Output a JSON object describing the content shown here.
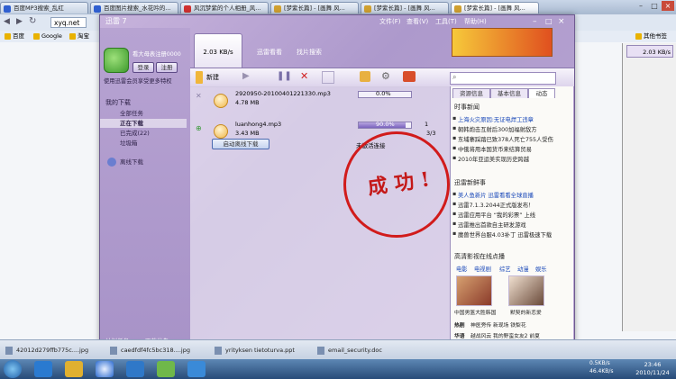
{
  "browser": {
    "tabs": [
      {
        "label": "百度MP3搜索_乱红",
        "color": "#2f5fd0"
      },
      {
        "label": "百度图片搜索_水花吟的...",
        "color": "#2f5fd0"
      },
      {
        "label": "风沉梦紫的个人相册_风...",
        "color": "#d03030"
      },
      {
        "label": "[梦紫长篇] - [画舞 风...",
        "color": "#d0a030"
      },
      {
        "label": "[梦紫长篇] - [画舞 风...",
        "color": "#d0a030"
      },
      {
        "label": "[梦紫长篇] - [画舞 风...",
        "color": "#d0a030"
      }
    ],
    "url": "xyq.net",
    "bookmarks": [
      "百度",
      "Google",
      "淘宝"
    ],
    "other_bookmarks": "其他书签",
    "right_speed": "2.03 KB/s"
  },
  "thunder": {
    "title": "迅雷 7",
    "menus": [
      "文件(F)",
      "查看(V)",
      "工具(T)",
      "帮助(H)"
    ],
    "user_text": "看大母表注册0000",
    "login_label": "登录",
    "register_label": "注册",
    "member_text": "使用迅雷会员享受更多特权",
    "my_downloads": "我的下载",
    "nav": [
      {
        "label": "全部任务"
      },
      {
        "label": "正在下载",
        "selected": true
      },
      {
        "label": "已完成(22)"
      },
      {
        "label": "垃圾箱"
      }
    ],
    "offline": "离线下载",
    "speed": "2.03 KB/s",
    "tabs": [
      "迅雷看看",
      "找片搜索"
    ],
    "new_label": "新建",
    "footer": [
      "计划任务",
      "下载优先"
    ],
    "tasks": [
      {
        "name": "2920950-20100401221330.mp3",
        "size": "4.78 MB",
        "progress": 0.0,
        "progress_text": "0.0%",
        "count": "",
        "status": ""
      },
      {
        "name": "luanhong4.mp3",
        "size": "3.43 MB",
        "progress": 0.9,
        "progress_text": "90.0%",
        "count": "3/3",
        "status": "未激活连接",
        "badge": "1"
      }
    ],
    "offline_btn": "启动离线下载",
    "info_tabs": [
      "资源信息",
      "基本信息",
      "动态"
    ],
    "news_title": "时事新闻",
    "news": [
      {
        "text": "上海火灾原因:无证电焊工违章",
        "blue": true
      },
      {
        "text": "朝韩炮击互射后300加福射敌方"
      },
      {
        "text": "东埔寨踩踏已致378人死亡755人受伤"
      },
      {
        "text": "中俄将用本国货币来结算贸易"
      },
      {
        "text": "2010年亚运美实现历史跨越"
      }
    ],
    "xunlei_title": "迅雷新鲜事",
    "xunlei": [
      {
        "text": "美人鱼新片 迅雷看看全球直播",
        "blue": true
      },
      {
        "text": "迅雷7.1.3.2044正式版发布！"
      },
      {
        "text": "迅雷应用平台 “我的彩票” 上线"
      },
      {
        "text": "迅雷推出首款自主研发游戏"
      },
      {
        "text": "魔兽世界台服4.03补丁 迅雷极速下载"
      }
    ],
    "video_title": "高清影视在线点播",
    "video_tabs": [
      "电影",
      "电视剧",
      "综艺",
      "动漫",
      "娱乐"
    ],
    "thumbs": [
      {
        "caption": "中国男篮大胜韩国"
      },
      {
        "caption": "默契的新恋爱"
      }
    ],
    "hot_rows": [
      {
        "head": "热剧",
        "items": "神医旁传 新现场 铁梨花"
      },
      {
        "head": "华语",
        "items": "越战风云 我的野蛮女友2 前夏"
      }
    ],
    "stamp_text": "成 功 !"
  },
  "downloads": [
    "42012d279ffb775c....jpg",
    "caedfdf4fc5bc318....jpg",
    "yrityksen tietoturva.ppt",
    "email_security.doc"
  ],
  "clock": {
    "time": "23:46",
    "date": "2010/11/24"
  },
  "tray": {
    "speed": "0.5KB/s",
    "speed2": "46.4KB/s"
  }
}
